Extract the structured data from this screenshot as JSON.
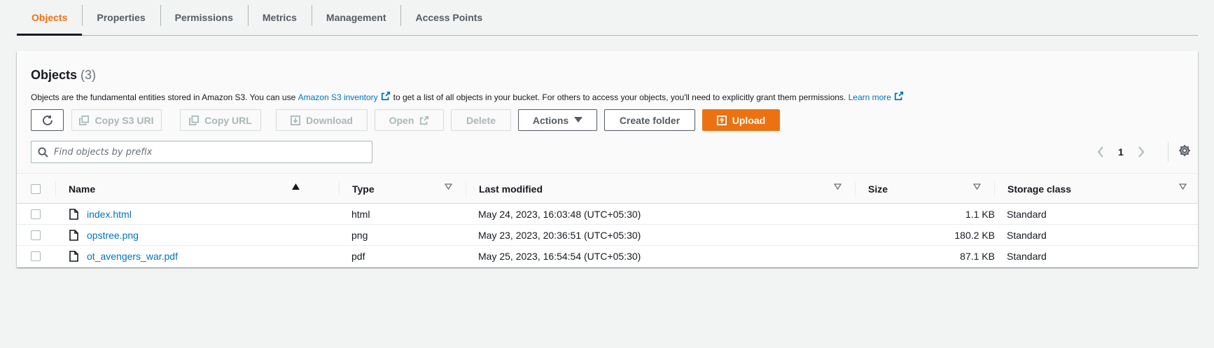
{
  "tabs": [
    {
      "label": "Objects",
      "active": true
    },
    {
      "label": "Properties",
      "active": false
    },
    {
      "label": "Permissions",
      "active": false
    },
    {
      "label": "Metrics",
      "active": false
    },
    {
      "label": "Management",
      "active": false
    },
    {
      "label": "Access Points",
      "active": false
    }
  ],
  "panel": {
    "title": "Objects",
    "count": "(3)",
    "description": {
      "part1": "Objects are the fundamental entities stored in Amazon S3. You can use",
      "inventory_link": "Amazon S3 inventory",
      "part2": "to get a list of all objects in your bucket. For others to access your objects, you'll need to explicitly grant them permissions.",
      "learn_more": "Learn more"
    }
  },
  "toolbar": {
    "copy_s3_uri": "Copy S3 URI",
    "copy_url": "Copy URL",
    "download": "Download",
    "open": "Open",
    "delete": "Delete",
    "actions": "Actions",
    "create_folder": "Create folder",
    "upload": "Upload"
  },
  "search": {
    "placeholder": "Find objects by prefix",
    "value": ""
  },
  "pagination": {
    "current_page": "1"
  },
  "table": {
    "columns": {
      "name": "Name",
      "type": "Type",
      "last_modified": "Last modified",
      "size": "Size",
      "storage_class": "Storage class"
    },
    "rows": [
      {
        "name": "index.html",
        "type": "html",
        "last_modified": "May 24, 2023, 16:03:48 (UTC+05:30)",
        "size": "1.1 KB",
        "storage_class": "Standard"
      },
      {
        "name": "opstree.png",
        "type": "png",
        "last_modified": "May 23, 2023, 20:36:51 (UTC+05:30)",
        "size": "180.2 KB",
        "storage_class": "Standard"
      },
      {
        "name": "ot_avengers_war.pdf",
        "type": "pdf",
        "last_modified": "May 25, 2023, 16:54:54 (UTC+05:30)",
        "size": "87.1 KB",
        "storage_class": "Standard"
      }
    ]
  },
  "colors": {
    "accent": "#ec7211",
    "link": "#0073bb",
    "text": "#16191f",
    "muted": "#687078",
    "background": "#f2f3f3"
  }
}
